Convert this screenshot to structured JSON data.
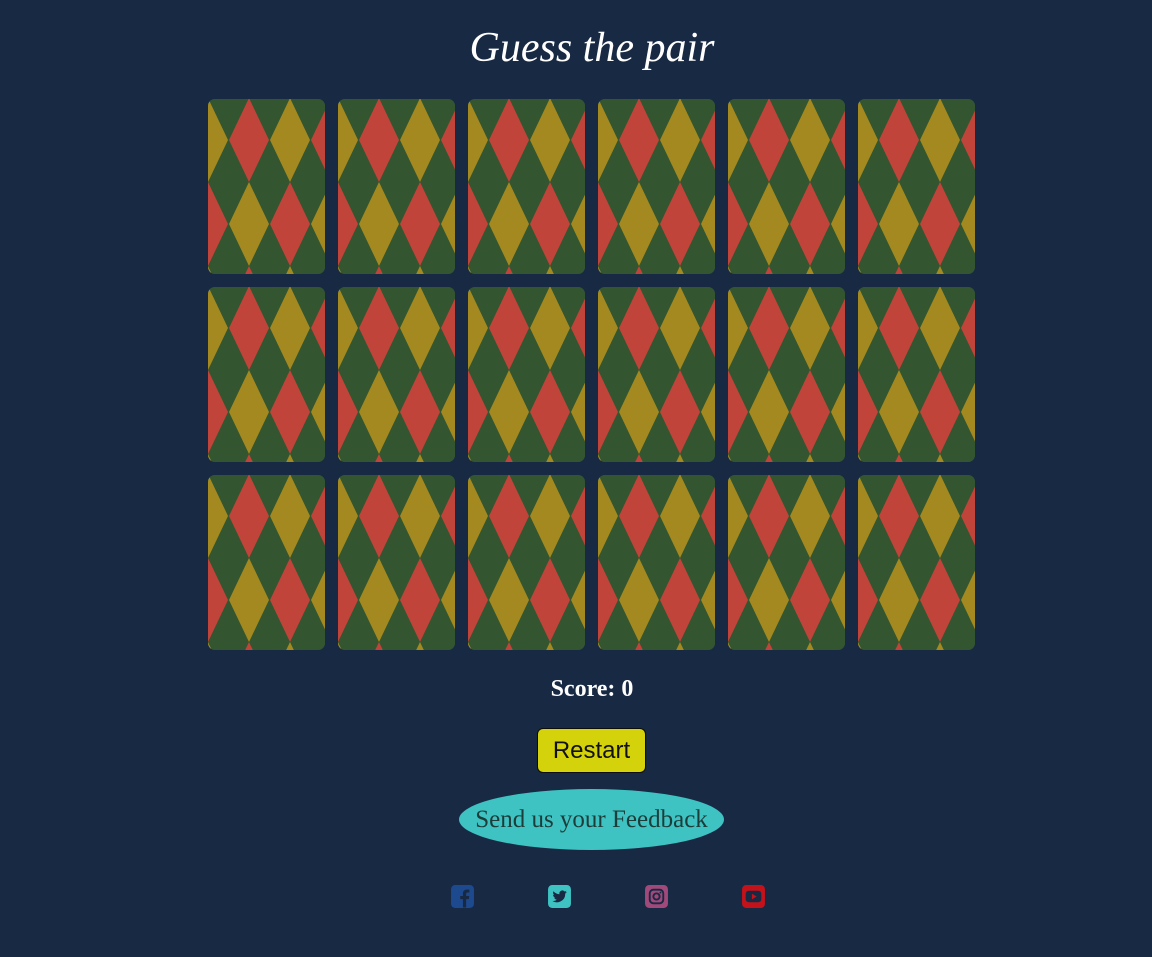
{
  "title": "Guess the pair",
  "board": {
    "rows": 3,
    "columns": 6,
    "card_back_colors": {
      "base": "#33552f",
      "gold": "#a38920",
      "red": "#c0443a"
    }
  },
  "score": {
    "label": "Score: 0",
    "value": 0
  },
  "restart_label": "Restart",
  "feedback_label": "Send us your Feedback",
  "social": [
    {
      "name": "facebook-icon",
      "color": "#1d4a8f"
    },
    {
      "name": "twitter-icon",
      "color": "#3ec2c2"
    },
    {
      "name": "instagram-icon",
      "color": "#a0497a"
    },
    {
      "name": "youtube-icon",
      "color": "#c4121b"
    }
  ],
  "colors": {
    "background": "#182944",
    "restart_button": "#d4d20a",
    "feedback_button": "#3ec2c2"
  }
}
